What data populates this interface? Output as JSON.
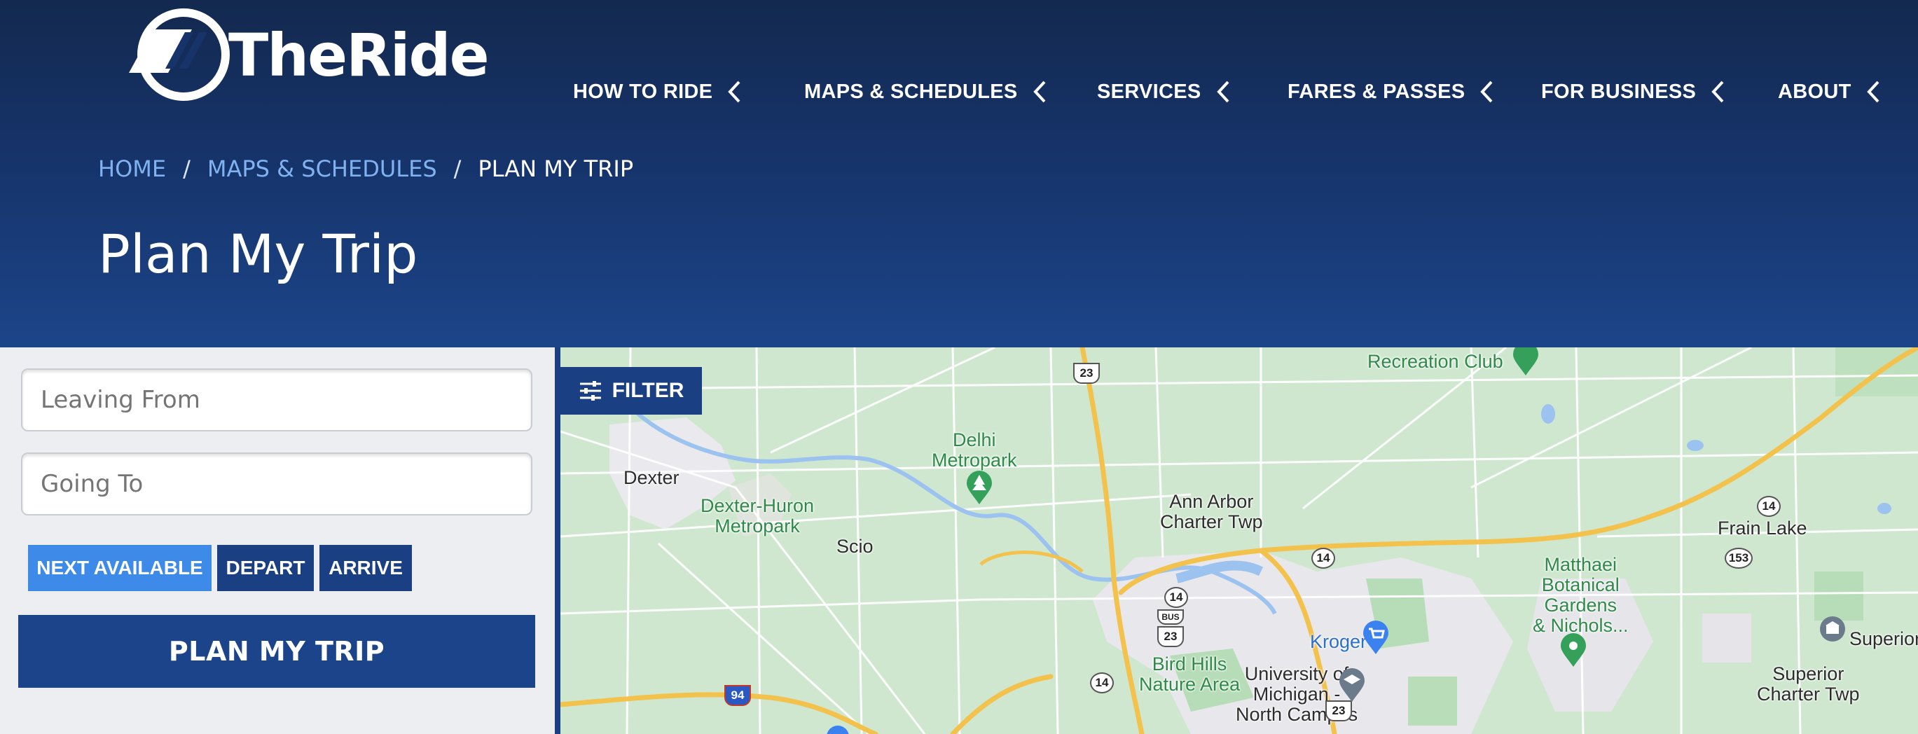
{
  "brand": {
    "name": "TheRide"
  },
  "nav": [
    {
      "label": "HOW TO RIDE"
    },
    {
      "label": "MAPS & SCHEDULES"
    },
    {
      "label": "SERVICES"
    },
    {
      "label": "FARES & PASSES"
    },
    {
      "label": "FOR BUSINESS"
    },
    {
      "label": "ABOUT"
    }
  ],
  "breadcrumb": {
    "home": "HOME",
    "maps": "MAPS & SCHEDULES",
    "current": "PLAN MY TRIP",
    "separator": "/"
  },
  "page_title": "Plan My Trip",
  "trip_form": {
    "from_placeholder": "Leaving From",
    "to_placeholder": "Going To",
    "modes": [
      {
        "label": "NEXT AVAILABLE",
        "active": true
      },
      {
        "label": "DEPART",
        "active": false
      },
      {
        "label": "ARRIVE",
        "active": false
      }
    ],
    "submit_label": "PLAN MY TRIP"
  },
  "map": {
    "filter_label": "FILTER",
    "labels": {
      "recreation_club": "Recreation Club",
      "dexter": "Dexter",
      "delhi": "Delhi\nMetropark",
      "dexter_huron": "Dexter-Huron\nMetropark",
      "scio": "Scio",
      "ann_arbor_twp": "Ann Arbor\nCharter Twp",
      "frain_lake": "Frain Lake",
      "matthaei": "Matthaei\nBotanical\nGardens\n& Nichols...",
      "kroger": "Kroger",
      "bird_hills": "Bird Hills\nNature Area",
      "umich": "University of\nMichigan -\nNorth Campus",
      "superior": "Superior",
      "superior_twp": "Superior\nCharter Twp"
    },
    "shields": {
      "us23_top": "23",
      "us23_mid": "23",
      "us23_bottom": "23",
      "bus": "BUS",
      "m14_a": "14",
      "m14_b": "14",
      "m14_c": "14",
      "m14_d": "14",
      "m153": "153",
      "i94": "94"
    }
  },
  "colors": {
    "header_top": "#13294f",
    "header_bottom": "#1c4589",
    "button_active": "#3d8ae8",
    "button_primary": "#1a3f82",
    "map_park": "#cfe7cf",
    "map_highway": "#f3c24d"
  },
  "icons": {
    "logo": "theride-logo-icon",
    "nav_chevron": "chevron-left-icon",
    "filter": "sliders-icon",
    "park_pin": "tree-pin-icon",
    "shopping_pin": "cart-pin-icon",
    "school_pin": "graduation-cap-pin-icon",
    "museum_pin": "building-pin-icon",
    "garden_pin": "flower-pin-icon"
  }
}
